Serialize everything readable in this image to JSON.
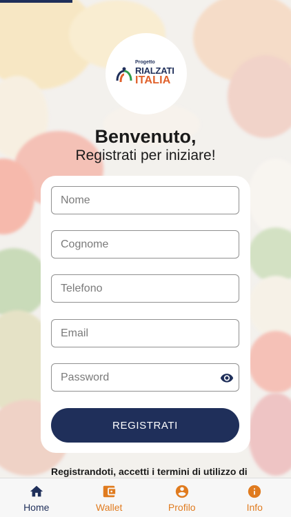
{
  "logo": {
    "small_text": "Progetto",
    "line1": "RIALZATI",
    "line2": "ITALIA"
  },
  "welcome": {
    "title": "Benvenuto,",
    "subtitle": "Registrati per iniziare!"
  },
  "form": {
    "nome_placeholder": "Nome",
    "cognome_placeholder": "Cognome",
    "telefono_placeholder": "Telefono",
    "email_placeholder": "Email",
    "password_placeholder": "Password",
    "submit_label": "REGISTRATI"
  },
  "terms_text": "Registrandoti, accetti i termini di utilizzo di",
  "tabbar": {
    "items": [
      {
        "label": "Home",
        "icon": "home-icon",
        "active": true
      },
      {
        "label": "Wallet",
        "icon": "wallet-icon",
        "active": false
      },
      {
        "label": "Profilo",
        "icon": "profile-icon",
        "active": false
      },
      {
        "label": "Info",
        "icon": "info-icon",
        "active": false
      }
    ]
  },
  "colors": {
    "primary": "#1f2f5a",
    "accent": "#e07b1f",
    "logo_orange": "#e0602a"
  }
}
